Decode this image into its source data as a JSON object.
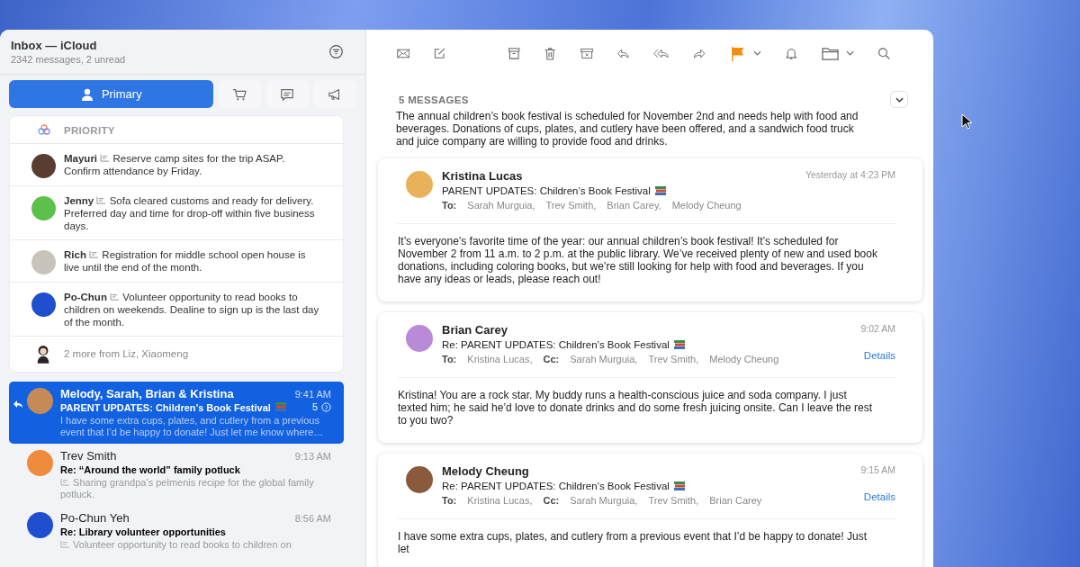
{
  "mailbox": {
    "title": "Inbox — iCloud",
    "subtitle": "2342 messages, 2 unread"
  },
  "tabs": [
    {
      "kind": "primary",
      "label": "Primary",
      "selected": true
    },
    {
      "kind": "cart",
      "selected": false
    },
    {
      "kind": "chat",
      "selected": false
    },
    {
      "kind": "megaphone",
      "selected": false
    }
  ],
  "priority": {
    "label": "PRIORITY",
    "items": [
      {
        "sender": "Mayuri",
        "text": "Reserve camp sites for the trip ASAP. Confirm attendance by Friday.",
        "color": "#5a3d30"
      },
      {
        "sender": "Jenny",
        "text": "Sofa cleared customs and ready for delivery. Preferred day and time for drop-off within five business days.",
        "color": "#5cc04a"
      },
      {
        "sender": "Rich",
        "text": "Registration for middle school open house is live until the end of the month.",
        "color": "#c9c4bb"
      },
      {
        "sender": "Po-Chun",
        "text": "Volunteer opportunity to read books to children on weekends. Dealine to sign up is the last day of the month.",
        "color": "#1f4fcf"
      }
    ],
    "more": "2 more from Liz, Xiaomeng"
  },
  "messages": [
    {
      "sender": "Melody, Sarah, Brian & Kristina",
      "time": "9:41 AM",
      "subject": "PARENT UPDATES: Children’s Book Festival",
      "preview": "I have some extra cups, plates, and cutlery from a previous event that I’d be happy to donate! Just let me know where…",
      "count": "5",
      "replied": true,
      "selected": true,
      "color": "#c58a55"
    },
    {
      "sender": "Trev Smith",
      "time": "9:13 AM",
      "subject": "Re: “Around the world” family potluck",
      "preview": "Sharing grandpa’s pelmenis recipe for the global family potluck.",
      "replied": false,
      "selected": false,
      "color": "#f08a3c"
    },
    {
      "sender": "Po-Chun Yeh",
      "time": "8:56 AM",
      "subject": "Re: Library volunteer opportunities",
      "preview": "Volunteer opportunity to read books to children on",
      "replied": false,
      "selected": false,
      "color": "#1f4fcf"
    }
  ],
  "toolbar": [
    {
      "kind": "mail"
    },
    {
      "kind": "compose"
    },
    {
      "kind": "archive"
    },
    {
      "kind": "trash"
    },
    {
      "kind": "junk"
    },
    {
      "kind": "reply"
    },
    {
      "kind": "reply-all"
    },
    {
      "kind": "forward"
    },
    {
      "kind": "flag"
    },
    {
      "kind": "bell"
    },
    {
      "kind": "folder"
    },
    {
      "kind": "search"
    }
  ],
  "thread": {
    "count_label": "5 MESSAGES",
    "summary": "The annual children’s book festival is scheduled for November 2nd and needs help with food and beverages. Donations of cups, plates, and cutlery have been offered, and a sandwich food truck and juice company are willing to provide food and drinks.",
    "messages": [
      {
        "sender": "Kristina Lucas",
        "time": "Yesterday at 4:23 PM",
        "subject": "PARENT UPDATES: Children’s Book Festival",
        "to_label": "To:",
        "to": [
          "Sarah Murguia,",
          "Trev Smith,",
          "Brian Carey,",
          "Melody Cheung"
        ],
        "body": "It’s everyone’s favorite time of the year: our annual children’s book festival! It’s scheduled for November 2 from 11 a.m. to 2 p.m. at the public library. We’ve received plenty of new and used book donations, including coloring books, but we’re still looking for help with food and beverages. If you have any ideas or leads, please reach out!",
        "color": "#e9b25a"
      },
      {
        "sender": "Brian Carey",
        "time": "9:02 AM",
        "subject": "Re: PARENT UPDATES: Children’s Book Festival",
        "to_label": "To:",
        "to": [
          "Kristina Lucas,"
        ],
        "cc_label": "Cc:",
        "cc": [
          "Sarah Murguia,",
          "Trev Smith,",
          "Melody Cheung"
        ],
        "details": "Details",
        "body": "Kristina! You are a rock star. My buddy runs a health-conscious juice and soda company. I just texted him; he said he’d love to donate drinks and do some fresh juicing onsite. Can I leave the rest to you two?",
        "color": "#b98ad8"
      },
      {
        "sender": "Melody Cheung",
        "time": "9:15 AM",
        "subject": "Re: PARENT UPDATES: Children’s Book Festival",
        "to_label": "To:",
        "to": [
          "Kristina Lucas,"
        ],
        "cc_label": "Cc:",
        "cc": [
          "Sarah Murguia,",
          "Trev Smith,",
          "Brian Carey"
        ],
        "details": "Details",
        "body": "I have some extra cups, plates, and cutlery from a previous event that I’d be happy to donate! Just let",
        "color": "#8a5a3c"
      }
    ]
  }
}
